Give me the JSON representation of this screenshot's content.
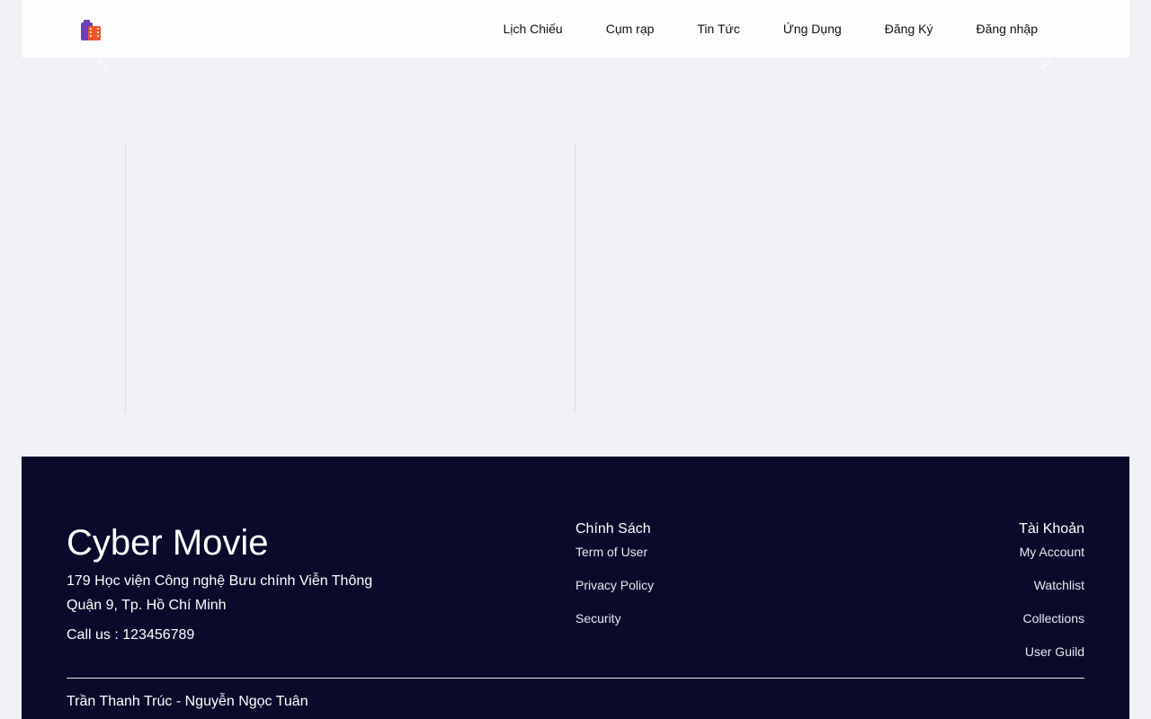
{
  "header": {
    "logo_icon": "film-reel-icon",
    "nav": [
      {
        "label": "Lịch Chiếu"
      },
      {
        "label": "Cụm rạp"
      },
      {
        "label": "Tin Tức"
      },
      {
        "label": "Ứng Dụng"
      },
      {
        "label": "Đăng Ký"
      },
      {
        "label": "Đăng nhập"
      }
    ]
  },
  "carousel": {
    "prev_icon": "chevron-left-icon",
    "next_icon": "chevron-right-icon"
  },
  "footer": {
    "brand": "Cyber Movie",
    "address_line1": "179 Học viện Công nghệ Bưu chính Viễn Thông",
    "address_line2": "Quận 9, Tp. Hồ Chí Minh",
    "phone": "Call us : 123456789",
    "policy": {
      "title": "Chính Sách",
      "links": [
        "Term of User",
        "Privacy Policy",
        "Security"
      ]
    },
    "account": {
      "title": "Tài Khoản",
      "links": [
        "My Account",
        "Watchlist",
        "Collections",
        "User Guild"
      ]
    },
    "credits": "Trần Thanh Trúc - Nguyễn Ngọc Tuân"
  },
  "colors": {
    "background": "#f0f2f5",
    "header": "#fdfdfd",
    "footer": "#0a0a2c",
    "logo_purple": "#6b3fb8",
    "logo_orange": "#f0562a"
  }
}
